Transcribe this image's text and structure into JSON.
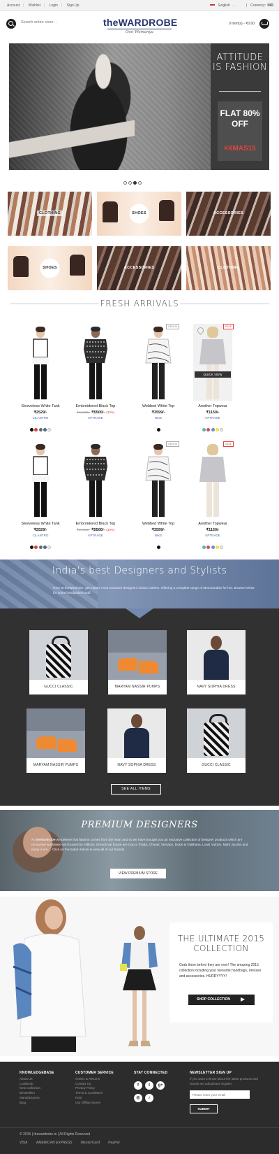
{
  "topbar": {
    "account": "Account",
    "wishlist": "Wishlist",
    "login": "Login",
    "signup": "Sign Up",
    "language": "English",
    "currency_label": "Currency:",
    "currency_value": "INR"
  },
  "header": {
    "search_placeholder": "Search entire store...",
    "logo_main": "theWARDROBE",
    "logo_tagline": "Ooo Womanya",
    "cart": "0 Item(s) - ₹0.00"
  },
  "hero": {
    "headline": "ATTITUDE IS FASHION",
    "offer": "FLAT 80% OFF",
    "hashtag": "#XMAS15"
  },
  "categories": [
    "CLOTHING",
    "SHOES",
    "ACCESSORIES",
    "SHOES",
    "ACCESSORIES",
    "CLOTHING"
  ],
  "fresh": {
    "title": "FRESH ARRIVALS",
    "quick_view": "QUICK VIEW",
    "products": [
      {
        "name": "Sleeveless White Tank",
        "old": "",
        "price": "₹2529/-",
        "off": "",
        "brand": "CILANTRO",
        "badge": "",
        "colors": [
          "#111111",
          "#d9443a",
          "#6b6b6b",
          "#4e6a8f",
          "#eeeeee"
        ]
      },
      {
        "name": "Embroidered Black Top",
        "old": "₹16,258/-",
        "price": "₹5500/-",
        "off": "(30%)",
        "brand": "KPTRADE",
        "badge": "",
        "colors": []
      },
      {
        "name": "Webbed White Top",
        "old": "",
        "price": "₹3599/-",
        "off": "",
        "brand": "NIKE",
        "badge": "NEW IN",
        "colors": [
          "#111111"
        ]
      },
      {
        "name": "Another Topwear",
        "old": "",
        "price": "₹1150/-",
        "off": "",
        "brand": "KPTRADE",
        "badge": "SALE",
        "colors": [
          "#5bb8a8",
          "#d94a6a",
          "#6a8fd0",
          "#f2e23a",
          "#eeeeee"
        ]
      },
      {
        "name": "Sleeveless White Tank",
        "old": "",
        "price": "₹2529/-",
        "off": "",
        "brand": "CILANTRO",
        "badge": "",
        "colors": [
          "#111111",
          "#d9443a",
          "#6b6b6b",
          "#4e6a8f",
          "#eeeeee"
        ]
      },
      {
        "name": "Embroidered Black Top",
        "old": "₹16,258/-",
        "price": "₹5500/-",
        "off": "(30%)",
        "brand": "KPTRADE",
        "badge": "",
        "colors": []
      },
      {
        "name": "Webbed White Top",
        "old": "",
        "price": "₹3599/-",
        "off": "",
        "brand": "NIKE",
        "badge": "NEW IN",
        "colors": [
          "#111111"
        ]
      },
      {
        "name": "Another Topwear",
        "old": "",
        "price": "₹1150/-",
        "off": "",
        "brand": "KPTRADE",
        "badge": "SALE",
        "colors": [
          "#5bb8a8",
          "#d94a6a",
          "#6a8fd0",
          "#f2e23a",
          "#eeeeee"
        ]
      }
    ]
  },
  "designers": {
    "title": "India's best Designers and Stylists",
    "text": "Here at theWardrobe, get India's most exclusive designers choice clothes. Offering a complete range of Merchandise for her. Browse below for some handpicked stuff.",
    "cards": [
      "GUCCI CLASSIC",
      "MARYAM NASSIR PUMPS",
      "NAVY SOPHIA DRESS",
      "MARYAM NASSIR PUMPS",
      "NAVY SOPHIA DRESS",
      "GUCCI CLASSIC"
    ],
    "see_all": "SEE ALL ITEMS"
  },
  "premium": {
    "title": "PREMIUM DESIGNERS",
    "brand": "theWardrobe",
    "text_before": "At ",
    "text_after": " we believe that fashion comes from the heart and so we have brought you an exclusive collection of designer products which are renowned  worldwide and trusted by millions. Brands we house are Gucci, Prada, Chanel, Versace, Dolce & Gabbana, Louis Vuitton, Mark Jacobs and many more.... Click on the button below to view all of our brands.",
    "button": "VIEW PREMIUM STORE"
  },
  "ultimate": {
    "title": "THE ULTIMATE 2015 COLLECTION",
    "text": "Grab them before they are over! The amazing 2015 collection including your favourite handbags, dresses and accessories. HURRYYYY!",
    "button": "SHOP COLLECTION"
  },
  "footer": {
    "kb_title": "KNOWLEDGEBASE",
    "kb_items": [
      "About Us",
      "Lookbook",
      "New Collection",
      "Bestsellers",
      "Manufacturers",
      "Blog"
    ],
    "cs_title": "CUSTOMER SERVICE",
    "cs_items": [
      "Orders & Returns",
      "Contact Us",
      "Privacy Policy",
      "Terms & Conditions",
      "RSS",
      "Our Offline Stores"
    ],
    "social_title": "STAY CONNECTED",
    "social_icons": [
      "f",
      "t",
      "g+",
      "◎",
      "♪"
    ],
    "news_title": "NEWSLETTER SIGN UP",
    "news_text": "If you want to know about the latest products and brands we add please register",
    "email_placeholder": "Please enter your email",
    "submit": "SUBMIT",
    "copyright": "© 2015 | thewardrobe.in | All Rights Reserved",
    "payments": [
      "VISA",
      "AMERICAN EXPRESS",
      "MasterCard",
      "PayPal"
    ]
  }
}
